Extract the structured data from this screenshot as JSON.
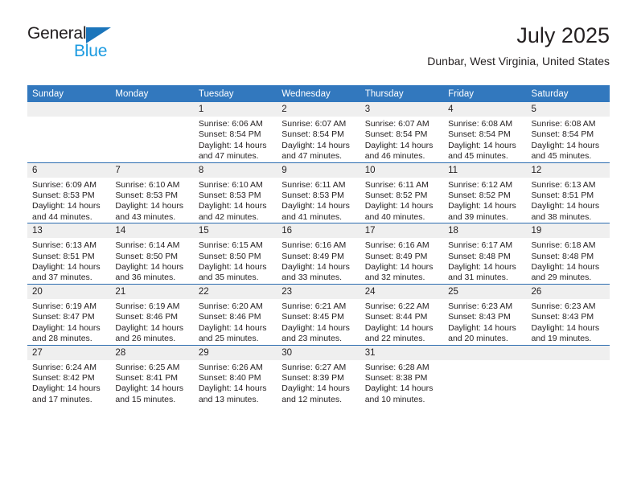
{
  "brand": {
    "name_part1": "General",
    "name_part2": "Blue",
    "accent_dark": "#1b75bb",
    "accent_light": "#1b9ae0"
  },
  "header": {
    "title": "July 2025",
    "subtitle": "Dunbar, West Virginia, United States"
  },
  "theme": {
    "header_bg": "#3278be",
    "row_divider": "#2c6cb0",
    "day_band_bg": "#efefef"
  },
  "weekday_headers": [
    "Sunday",
    "Monday",
    "Tuesday",
    "Wednesday",
    "Thursday",
    "Friday",
    "Saturday"
  ],
  "weeks": [
    [
      {
        "day": "",
        "sunrise": "",
        "sunset": "",
        "daylight1": "",
        "daylight2": "",
        "blank": true
      },
      {
        "day": "",
        "sunrise": "",
        "sunset": "",
        "daylight1": "",
        "daylight2": "",
        "blank": true
      },
      {
        "day": "1",
        "sunrise": "Sunrise: 6:06 AM",
        "sunset": "Sunset: 8:54 PM",
        "daylight1": "Daylight: 14 hours",
        "daylight2": "and 47 minutes."
      },
      {
        "day": "2",
        "sunrise": "Sunrise: 6:07 AM",
        "sunset": "Sunset: 8:54 PM",
        "daylight1": "Daylight: 14 hours",
        "daylight2": "and 47 minutes."
      },
      {
        "day": "3",
        "sunrise": "Sunrise: 6:07 AM",
        "sunset": "Sunset: 8:54 PM",
        "daylight1": "Daylight: 14 hours",
        "daylight2": "and 46 minutes."
      },
      {
        "day": "4",
        "sunrise": "Sunrise: 6:08 AM",
        "sunset": "Sunset: 8:54 PM",
        "daylight1": "Daylight: 14 hours",
        "daylight2": "and 45 minutes."
      },
      {
        "day": "5",
        "sunrise": "Sunrise: 6:08 AM",
        "sunset": "Sunset: 8:54 PM",
        "daylight1": "Daylight: 14 hours",
        "daylight2": "and 45 minutes."
      }
    ],
    [
      {
        "day": "6",
        "sunrise": "Sunrise: 6:09 AM",
        "sunset": "Sunset: 8:53 PM",
        "daylight1": "Daylight: 14 hours",
        "daylight2": "and 44 minutes."
      },
      {
        "day": "7",
        "sunrise": "Sunrise: 6:10 AM",
        "sunset": "Sunset: 8:53 PM",
        "daylight1": "Daylight: 14 hours",
        "daylight2": "and 43 minutes."
      },
      {
        "day": "8",
        "sunrise": "Sunrise: 6:10 AM",
        "sunset": "Sunset: 8:53 PM",
        "daylight1": "Daylight: 14 hours",
        "daylight2": "and 42 minutes."
      },
      {
        "day": "9",
        "sunrise": "Sunrise: 6:11 AM",
        "sunset": "Sunset: 8:53 PM",
        "daylight1": "Daylight: 14 hours",
        "daylight2": "and 41 minutes."
      },
      {
        "day": "10",
        "sunrise": "Sunrise: 6:11 AM",
        "sunset": "Sunset: 8:52 PM",
        "daylight1": "Daylight: 14 hours",
        "daylight2": "and 40 minutes."
      },
      {
        "day": "11",
        "sunrise": "Sunrise: 6:12 AM",
        "sunset": "Sunset: 8:52 PM",
        "daylight1": "Daylight: 14 hours",
        "daylight2": "and 39 minutes."
      },
      {
        "day": "12",
        "sunrise": "Sunrise: 6:13 AM",
        "sunset": "Sunset: 8:51 PM",
        "daylight1": "Daylight: 14 hours",
        "daylight2": "and 38 minutes."
      }
    ],
    [
      {
        "day": "13",
        "sunrise": "Sunrise: 6:13 AM",
        "sunset": "Sunset: 8:51 PM",
        "daylight1": "Daylight: 14 hours",
        "daylight2": "and 37 minutes."
      },
      {
        "day": "14",
        "sunrise": "Sunrise: 6:14 AM",
        "sunset": "Sunset: 8:50 PM",
        "daylight1": "Daylight: 14 hours",
        "daylight2": "and 36 minutes."
      },
      {
        "day": "15",
        "sunrise": "Sunrise: 6:15 AM",
        "sunset": "Sunset: 8:50 PM",
        "daylight1": "Daylight: 14 hours",
        "daylight2": "and 35 minutes."
      },
      {
        "day": "16",
        "sunrise": "Sunrise: 6:16 AM",
        "sunset": "Sunset: 8:49 PM",
        "daylight1": "Daylight: 14 hours",
        "daylight2": "and 33 minutes."
      },
      {
        "day": "17",
        "sunrise": "Sunrise: 6:16 AM",
        "sunset": "Sunset: 8:49 PM",
        "daylight1": "Daylight: 14 hours",
        "daylight2": "and 32 minutes."
      },
      {
        "day": "18",
        "sunrise": "Sunrise: 6:17 AM",
        "sunset": "Sunset: 8:48 PM",
        "daylight1": "Daylight: 14 hours",
        "daylight2": "and 31 minutes."
      },
      {
        "day": "19",
        "sunrise": "Sunrise: 6:18 AM",
        "sunset": "Sunset: 8:48 PM",
        "daylight1": "Daylight: 14 hours",
        "daylight2": "and 29 minutes."
      }
    ],
    [
      {
        "day": "20",
        "sunrise": "Sunrise: 6:19 AM",
        "sunset": "Sunset: 8:47 PM",
        "daylight1": "Daylight: 14 hours",
        "daylight2": "and 28 minutes."
      },
      {
        "day": "21",
        "sunrise": "Sunrise: 6:19 AM",
        "sunset": "Sunset: 8:46 PM",
        "daylight1": "Daylight: 14 hours",
        "daylight2": "and 26 minutes."
      },
      {
        "day": "22",
        "sunrise": "Sunrise: 6:20 AM",
        "sunset": "Sunset: 8:46 PM",
        "daylight1": "Daylight: 14 hours",
        "daylight2": "and 25 minutes."
      },
      {
        "day": "23",
        "sunrise": "Sunrise: 6:21 AM",
        "sunset": "Sunset: 8:45 PM",
        "daylight1": "Daylight: 14 hours",
        "daylight2": "and 23 minutes."
      },
      {
        "day": "24",
        "sunrise": "Sunrise: 6:22 AM",
        "sunset": "Sunset: 8:44 PM",
        "daylight1": "Daylight: 14 hours",
        "daylight2": "and 22 minutes."
      },
      {
        "day": "25",
        "sunrise": "Sunrise: 6:23 AM",
        "sunset": "Sunset: 8:43 PM",
        "daylight1": "Daylight: 14 hours",
        "daylight2": "and 20 minutes."
      },
      {
        "day": "26",
        "sunrise": "Sunrise: 6:23 AM",
        "sunset": "Sunset: 8:43 PM",
        "daylight1": "Daylight: 14 hours",
        "daylight2": "and 19 minutes."
      }
    ],
    [
      {
        "day": "27",
        "sunrise": "Sunrise: 6:24 AM",
        "sunset": "Sunset: 8:42 PM",
        "daylight1": "Daylight: 14 hours",
        "daylight2": "and 17 minutes."
      },
      {
        "day": "28",
        "sunrise": "Sunrise: 6:25 AM",
        "sunset": "Sunset: 8:41 PM",
        "daylight1": "Daylight: 14 hours",
        "daylight2": "and 15 minutes."
      },
      {
        "day": "29",
        "sunrise": "Sunrise: 6:26 AM",
        "sunset": "Sunset: 8:40 PM",
        "daylight1": "Daylight: 14 hours",
        "daylight2": "and 13 minutes."
      },
      {
        "day": "30",
        "sunrise": "Sunrise: 6:27 AM",
        "sunset": "Sunset: 8:39 PM",
        "daylight1": "Daylight: 14 hours",
        "daylight2": "and 12 minutes."
      },
      {
        "day": "31",
        "sunrise": "Sunrise: 6:28 AM",
        "sunset": "Sunset: 8:38 PM",
        "daylight1": "Daylight: 14 hours",
        "daylight2": "and 10 minutes."
      },
      {
        "day": "",
        "sunrise": "",
        "sunset": "",
        "daylight1": "",
        "daylight2": "",
        "blank": true
      },
      {
        "day": "",
        "sunrise": "",
        "sunset": "",
        "daylight1": "",
        "daylight2": "",
        "blank": true
      }
    ]
  ]
}
